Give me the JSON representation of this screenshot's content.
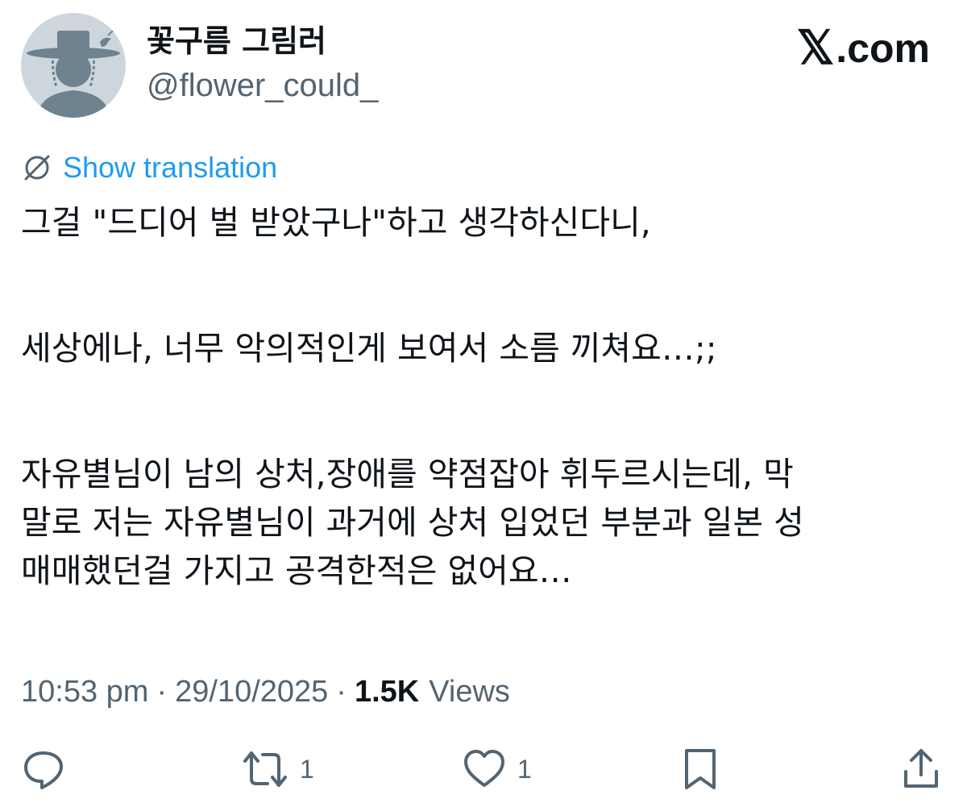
{
  "author": {
    "display_name": "꽃구름 그림러",
    "handle": "@flower_could_",
    "avatar_icon": "hat-person-avatar-icon"
  },
  "brand": {
    "x_glyph": "𝕏",
    "domain": ".com"
  },
  "translation_link": {
    "label": "Show translation",
    "icon": "translate-icon",
    "color": "#1d9bf0"
  },
  "tweet": {
    "lines": [
      "그걸 \"드디어 벌 받았구나\"하고 생각하신다니,",
      "세상에나, 너무 악의적인게 보여서 소름 끼쳐요…;;",
      "자유별님이 남의 상처,장애를 약점잡아 휘두르시는데, 막",
      "말로 저는 자유별님이 과거에 상처 입었던 부분과 일본 성",
      "매매했던걸 가지고 공격한적은 없어요…"
    ]
  },
  "meta": {
    "time": "10:53 pm",
    "separator": "·",
    "date": "29/10/2025",
    "views_count": "1.5K",
    "views_label": "Views"
  },
  "actions": {
    "reply": {
      "icon": "reply-icon",
      "count": ""
    },
    "retweet": {
      "icon": "retweet-icon",
      "count": "1"
    },
    "like": {
      "icon": "heart-icon",
      "count": "1"
    },
    "bookmark": {
      "icon": "bookmark-icon"
    },
    "share": {
      "icon": "share-icon"
    }
  },
  "colors": {
    "text_primary": "#0f1419",
    "text_secondary": "#536471",
    "accent": "#1d9bf0",
    "avatar_bg": "#cdd6dd",
    "avatar_fg": "#6f8290"
  }
}
